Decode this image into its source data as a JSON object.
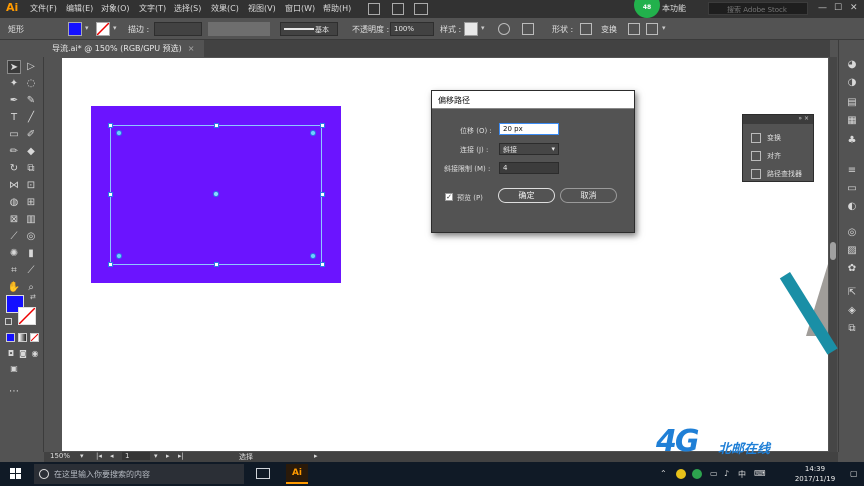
{
  "app": {
    "logo": "Ai",
    "doc_tab": "导流.ai* @ 150% (RGB/GPU 预选)",
    "tab_close": "×"
  },
  "menu": [
    "文件(F)",
    "编辑(E)",
    "对象(O)",
    "文字(T)",
    "选择(S)",
    "效果(C)",
    "视图(V)",
    "窗口(W)",
    "帮助(H)"
  ],
  "topbar_right": {
    "workspace_badge": "48",
    "workspace": "本功能",
    "search_placeholder": "搜索 Adobe Stock",
    "window_buttons": [
      "—",
      "☐",
      "✕"
    ]
  },
  "controlbar": {
    "shape_label": "矩形",
    "stroke_label": "描边 :",
    "stroke_value": "",
    "stroke_style": "基本",
    "opacity_label": "不透明度 :",
    "opacity_value": "100%",
    "style_label": "样式 :",
    "shape_btn": "形状 :",
    "transform_btn": "变换",
    "fill_color": "#1410ff"
  },
  "dialog": {
    "title": "偏移路径",
    "offset_label": "位移 (O) :",
    "offset_value": "20 px",
    "join_label": "连接 (J) :",
    "join_value": "斜接",
    "miter_label": "斜接限制 (M) :",
    "miter_value": "4",
    "preview_label": "预览 (P)",
    "preview_checked": "✓",
    "ok": "确定",
    "cancel": "取消"
  },
  "floatpanel": {
    "header": "» ×",
    "items": [
      "变换",
      "对齐",
      "路径查找器"
    ]
  },
  "statusbar": {
    "zoom": "150%",
    "artboard": "1",
    "status": "选择"
  },
  "canvas": {
    "shape_color": "#6b14ff",
    "accent_teal": "#1a8fa6"
  },
  "watermark": {
    "logo": "4G",
    "text": "北邮在线"
  },
  "taskbar": {
    "search_placeholder": "在这里输入你要搜索的内容",
    "app_ai": "Ai",
    "tray_lang": "中",
    "time": "14:39",
    "date": "2017/11/19"
  }
}
